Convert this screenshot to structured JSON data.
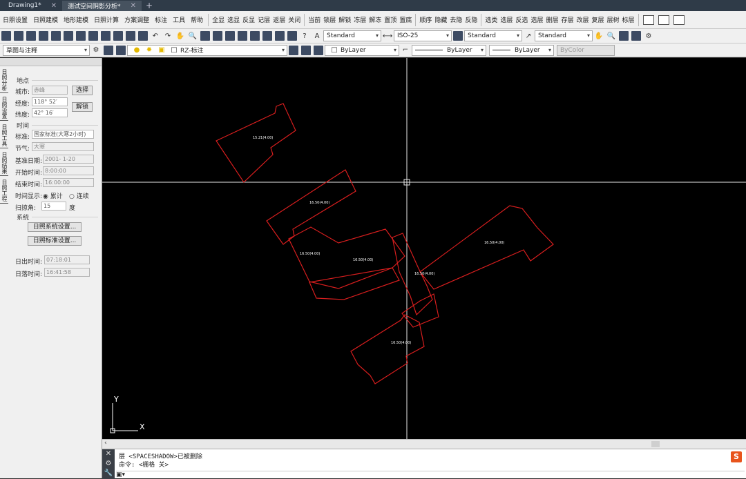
{
  "tabs": [
    {
      "label": "Drawing1*",
      "active": false
    },
    {
      "label": "测试空间阴影分析*",
      "active": true
    }
  ],
  "menu": [
    "日照设置",
    "日照建模",
    "地形建模",
    "日照计算",
    "方案调整",
    "标注",
    "工具",
    "帮助"
  ],
  "layer_tools": [
    "全显",
    "选显",
    "反显",
    "记层",
    "返层",
    "关闭",
    "当前",
    "锁层",
    "解锁",
    "冻层",
    "解冻",
    "置顶",
    "置底",
    "顺序",
    "隐藏",
    "去隐",
    "反隐",
    "选类",
    "选层",
    "反选",
    "选层",
    "删层",
    "存层",
    "改层",
    "复层",
    "层树",
    "标层"
  ],
  "styles": {
    "text_style": "Standard",
    "dim_style": "ISO-25",
    "table_style": "Standard",
    "mleader_style": "Standard"
  },
  "props": {
    "workspace": "草图与注释",
    "layer": "RZ-标注",
    "color": "ByLayer",
    "linetype": "ByLayer",
    "lineweight": "ByLayer",
    "plotstyle": "ByColor"
  },
  "panel": {
    "vtabs": [
      "日照分析",
      "日照设置",
      "日照工具",
      "日照结果",
      "日照工程"
    ],
    "location_title": "地点",
    "city_label": "城市:",
    "city_value": "赤峰",
    "select_btn": "选择",
    "lon_label": "经度:",
    "lon_value": "118° 52′",
    "lat_label": "纬度:",
    "lat_value": "42° 16′",
    "unlock_btn": "解锁",
    "time_title": "时间",
    "std_label": "标准:",
    "std_value": "国家标准(大寒2小时)",
    "solar_label": "节气:",
    "solar_value": "大寒",
    "date_label": "基准日期:",
    "date_value": "2001- 1-20",
    "start_label": "开始时间:",
    "start_value": "8:00:00",
    "end_label": "结束时间:",
    "end_value": "16:00:00",
    "display_label": "时间显示:",
    "display_opt1": "累计",
    "display_opt2": "连续",
    "sweep_label": "扫掠角:",
    "sweep_value": "15",
    "sweep_unit": "度",
    "system_title": "系统",
    "sys_btn": "日照系统设置...",
    "std_btn": "日照标准设置...",
    "sunrise_label": "日出时间:",
    "sunrise_value": "07:18:01",
    "sunset_label": "日落时间:",
    "sunset_value": "16:41:58"
  },
  "canvas": {
    "ucs_y": "Y",
    "ucs_x": "X",
    "building_labels": [
      "15.21(4.00)",
      "16.50(4.00)",
      "16.50(4.00)",
      "16.50(4.00)",
      "16.50(4.00)",
      "16.50(4.00)",
      "16.50(4.00)"
    ],
    "outline_color": "#d81e1e"
  },
  "command": {
    "line1": "层 <SPACESHADOW>已被删除",
    "line2": "命令:  <栅格 关>"
  }
}
